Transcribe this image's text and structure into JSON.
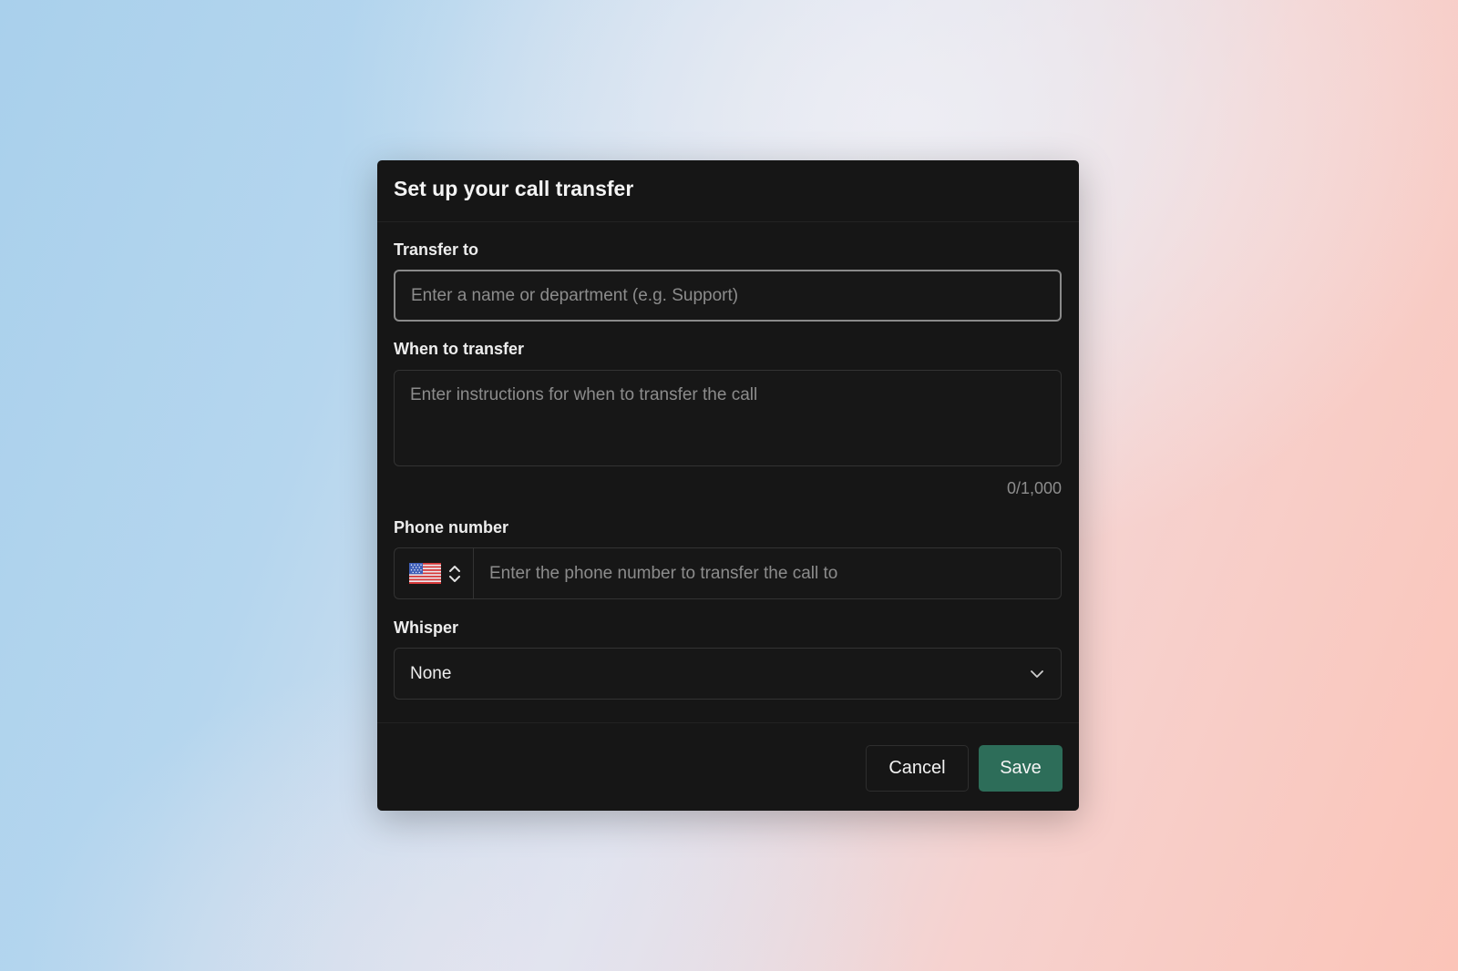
{
  "dialog": {
    "title": "Set up your call transfer",
    "transfer_to": {
      "label": "Transfer to",
      "placeholder": "Enter a name or department (e.g. Support)",
      "value": ""
    },
    "when_to_transfer": {
      "label": "When to transfer",
      "placeholder": "Enter instructions for when to transfer the call",
      "value": "",
      "counter": "0/1,000"
    },
    "phone_number": {
      "label": "Phone number",
      "country_flag": "us-flag-icon",
      "placeholder": "Enter the phone number to transfer the call to",
      "value": ""
    },
    "whisper": {
      "label": "Whisper",
      "selected": "None"
    },
    "buttons": {
      "cancel": "Cancel",
      "save": "Save"
    }
  },
  "colors": {
    "dialog_background": "#161616",
    "save_button": "#2d6d59",
    "focused_border": "#8a8a8a"
  }
}
